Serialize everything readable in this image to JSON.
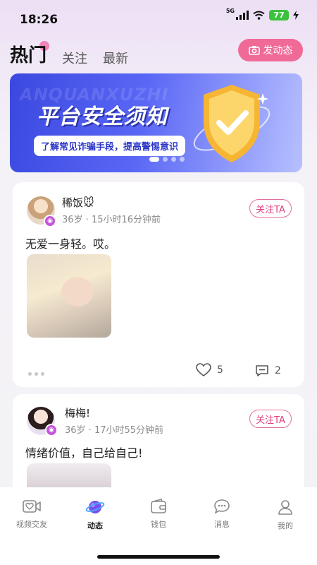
{
  "status": {
    "time": "18:26",
    "network": "5G",
    "battery": "77"
  },
  "header": {
    "tabs": [
      {
        "label": "热门",
        "active": true
      },
      {
        "label": "关注",
        "active": false
      },
      {
        "label": "最新",
        "active": false
      }
    ],
    "post_button": "发动态"
  },
  "banner": {
    "watermark": "ANQUANXUZHI",
    "title": "平台安全须知",
    "subtitle": "了解常见诈骗手段，提高警惕意识",
    "slides": 4,
    "active_slide": 0
  },
  "posts": [
    {
      "username": "稀饭🐭",
      "age": "36岁",
      "time": "15小时16分钟前",
      "follow_label": "关注TA",
      "content": "无爱一身轻。哎。",
      "likes": "5",
      "comments": "2"
    },
    {
      "username": "梅梅!",
      "age": "36岁",
      "time": "17小时55分钟前",
      "follow_label": "关注TA",
      "content": "情绪价值，自己给自己!"
    }
  ],
  "nav": [
    {
      "label": "视频交友",
      "icon": "video-heart-icon",
      "active": false
    },
    {
      "label": "动态",
      "icon": "planet-icon",
      "active": true
    },
    {
      "label": "钱包",
      "icon": "wallet-icon",
      "active": false
    },
    {
      "label": "消息",
      "icon": "message-icon",
      "active": false
    },
    {
      "label": "我的",
      "icon": "profile-icon",
      "active": false
    }
  ],
  "colors": {
    "accent": "#f06a98",
    "follow": "#e0407f",
    "banner": "#4b58ea",
    "nav_active": "#7a4ff0"
  }
}
